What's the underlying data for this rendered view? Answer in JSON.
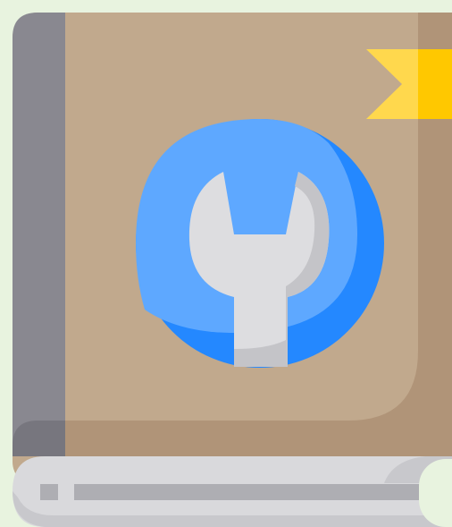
{
  "colors": {
    "background": "#e8f3df",
    "cover": "#c1a98d",
    "cover_shadow": "#b09478",
    "spine": "#898890",
    "spine_dark": "#77767e",
    "page_block": "#d9d9dc",
    "page_line": "#aeaeb3",
    "page_shadow": "#c8c8cc",
    "bookmark": "#ffc800",
    "bookmark_light": "#ffd84d",
    "emblem_blue": "#2488ff",
    "emblem_blue_light": "#5ea8ff",
    "wrench": "#dddde0",
    "wrench_shadow": "#c4c4c8"
  },
  "icons": {
    "book": "book-icon",
    "wrench": "wrench-icon",
    "bookmark": "bookmark-icon"
  }
}
